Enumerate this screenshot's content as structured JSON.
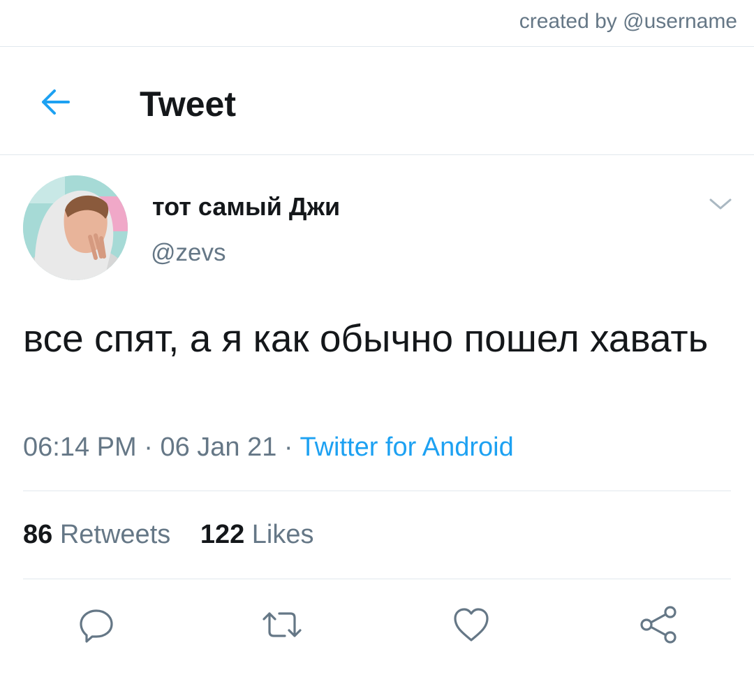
{
  "credit": {
    "text": "created by @username"
  },
  "header": {
    "title": "Tweet",
    "back_icon": "arrow-left-icon"
  },
  "tweet": {
    "display_name": "тот самый Джи",
    "handle": "@zevs",
    "text": "все спят, а я как обычно пошел хавать",
    "time": "06:14 PM",
    "date": "06 Jan 21",
    "separator": "·",
    "source": "Twitter for Android",
    "retweets": {
      "count": "86",
      "label": "Retweets"
    },
    "likes": {
      "count": "122",
      "label": "Likes"
    },
    "more_icon": "chevron-down-icon"
  },
  "actions": [
    {
      "icon": "reply-icon"
    },
    {
      "icon": "retweet-icon"
    },
    {
      "icon": "like-icon"
    },
    {
      "icon": "share-icon"
    }
  ],
  "colors": {
    "accent": "#1da1f2",
    "secondary_text": "#657786",
    "primary_text": "#14171a",
    "divider": "#e1e8ed"
  }
}
